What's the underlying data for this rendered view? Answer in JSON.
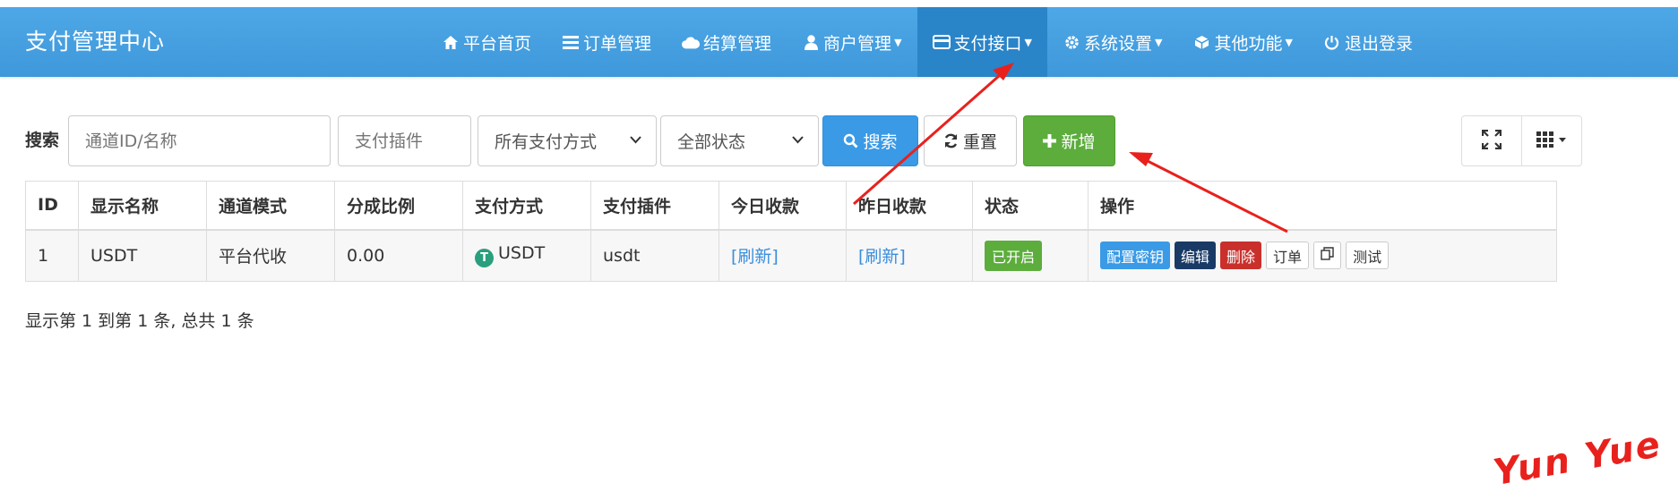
{
  "app": {
    "title": "支付管理中心"
  },
  "nav": {
    "items": [
      {
        "label": "平台首页",
        "icon": "home-icon",
        "dropdown": false
      },
      {
        "label": "订单管理",
        "icon": "list-icon",
        "dropdown": false
      },
      {
        "label": "结算管理",
        "icon": "cloud-icon",
        "dropdown": false
      },
      {
        "label": "商户管理",
        "icon": "user-icon",
        "dropdown": true
      },
      {
        "label": "支付接口",
        "icon": "credit-card-icon",
        "dropdown": true,
        "active": true
      },
      {
        "label": "系统设置",
        "icon": "gear-icon",
        "dropdown": true
      },
      {
        "label": "其他功能",
        "icon": "cube-icon",
        "dropdown": true
      },
      {
        "label": "退出登录",
        "icon": "power-icon",
        "dropdown": false
      }
    ]
  },
  "toolbar": {
    "search_label": "搜索",
    "channel_placeholder": "通道ID/名称",
    "plugin_placeholder": "支付插件",
    "paytype_selected": "所有支付方式",
    "status_selected": "全部状态",
    "search_button": "搜索",
    "reset_button": "重置",
    "add_button": "新增"
  },
  "table": {
    "headers": [
      "ID",
      "显示名称",
      "通道模式",
      "分成比例",
      "支付方式",
      "支付插件",
      "今日收款",
      "昨日收款",
      "状态",
      "操作"
    ],
    "rows": [
      {
        "id": "1",
        "name": "USDT",
        "mode": "平台代收",
        "ratio": "0.00",
        "paytype": "USDT",
        "paytype_icon": "T",
        "plugin": "usdt",
        "today": "[刷新]",
        "yesterday": "[刷新]",
        "status": "已开启",
        "actions": {
          "config_key": "配置密钥",
          "edit": "编辑",
          "delete": "删除",
          "orders": "订单",
          "test": "测试"
        }
      }
    ]
  },
  "footer": {
    "pagination_text": "显示第 1 到第 1 条, 总共 1 条"
  },
  "watermark": "Yun Yue",
  "colors": {
    "navbar": "#3e98da",
    "nav_active": "#2a84c8",
    "primary": "#3a9ae6",
    "success": "#5cad3c",
    "danger": "#c9302c",
    "dark": "#1a3a66",
    "annotation": "#e8211d"
  }
}
